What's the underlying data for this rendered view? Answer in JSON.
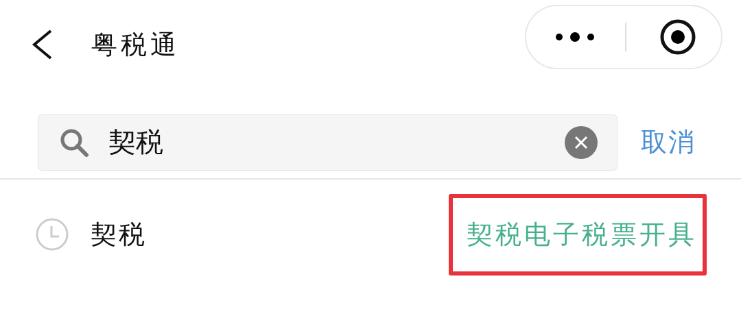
{
  "header": {
    "title": "粤税通"
  },
  "search": {
    "value": "契税",
    "action": "取消"
  },
  "history": [
    {
      "text": "契税",
      "suggestion": "契税电子税票开具",
      "highlighted": true
    }
  ]
}
